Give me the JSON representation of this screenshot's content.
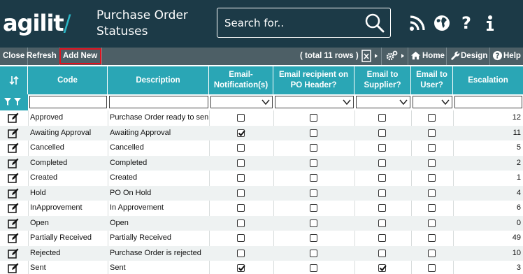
{
  "header": {
    "logo": {
      "text": "agilit",
      "accent": "/"
    },
    "title": "Purchase Order Statuses",
    "search_placeholder": "Search for..",
    "icons": [
      "rss-icon",
      "globe-icon",
      "help-icon",
      "info-icon"
    ]
  },
  "toolbar": {
    "close": "Close",
    "refresh": "Refresh",
    "add_new": "Add New",
    "total": "( total 11 rows )",
    "home": "Home",
    "design": "Design",
    "help": "Help"
  },
  "columns": {
    "code": "Code",
    "description": "Description",
    "email_notification": "Email-Notification(s)",
    "email_recipient": "Email recipient on PO Header?",
    "email_supplier": "Email to Supplier?",
    "email_user": "Email to User?",
    "escalation": "Escalation"
  },
  "rows": [
    {
      "code": "Approved",
      "description": "Purchase Order ready to sent",
      "email_notification": false,
      "email_recipient": false,
      "email_supplier": false,
      "email_user": false,
      "escalation": "12"
    },
    {
      "code": "Awaiting Approval",
      "description": "Awaiting Approval",
      "email_notification": true,
      "email_recipient": false,
      "email_supplier": false,
      "email_user": false,
      "escalation": "11"
    },
    {
      "code": "Cancelled",
      "description": "Cancelled",
      "email_notification": false,
      "email_recipient": false,
      "email_supplier": false,
      "email_user": false,
      "escalation": "5"
    },
    {
      "code": "Completed",
      "description": "Completed",
      "email_notification": false,
      "email_recipient": false,
      "email_supplier": false,
      "email_user": false,
      "escalation": "2"
    },
    {
      "code": "Created",
      "description": "Created",
      "email_notification": false,
      "email_recipient": false,
      "email_supplier": false,
      "email_user": false,
      "escalation": "1"
    },
    {
      "code": "Hold",
      "description": "PO On Hold",
      "email_notification": false,
      "email_recipient": false,
      "email_supplier": false,
      "email_user": false,
      "escalation": "4"
    },
    {
      "code": "InApprovement",
      "description": "In Approvement",
      "email_notification": false,
      "email_recipient": false,
      "email_supplier": false,
      "email_user": false,
      "escalation": "6"
    },
    {
      "code": "Open",
      "description": "Open",
      "email_notification": false,
      "email_recipient": false,
      "email_supplier": false,
      "email_user": false,
      "escalation": "0"
    },
    {
      "code": "Partially Received",
      "description": "Partially Received",
      "email_notification": false,
      "email_recipient": false,
      "email_supplier": false,
      "email_user": false,
      "escalation": "49"
    },
    {
      "code": "Rejected",
      "description": "Purchase Order is rejected",
      "email_notification": false,
      "email_recipient": false,
      "email_supplier": false,
      "email_user": false,
      "escalation": "10"
    },
    {
      "code": "Sent",
      "description": "Sent",
      "email_notification": true,
      "email_recipient": false,
      "email_supplier": true,
      "email_user": false,
      "escalation": "3"
    }
  ],
  "colors": {
    "header_bg": "#1c3a47",
    "toolbar_bg": "#4d5f66",
    "column_header_bg": "#2aa6b5",
    "logo_accent": "#2bb5c5",
    "add_new_highlight": "#e0121f"
  }
}
